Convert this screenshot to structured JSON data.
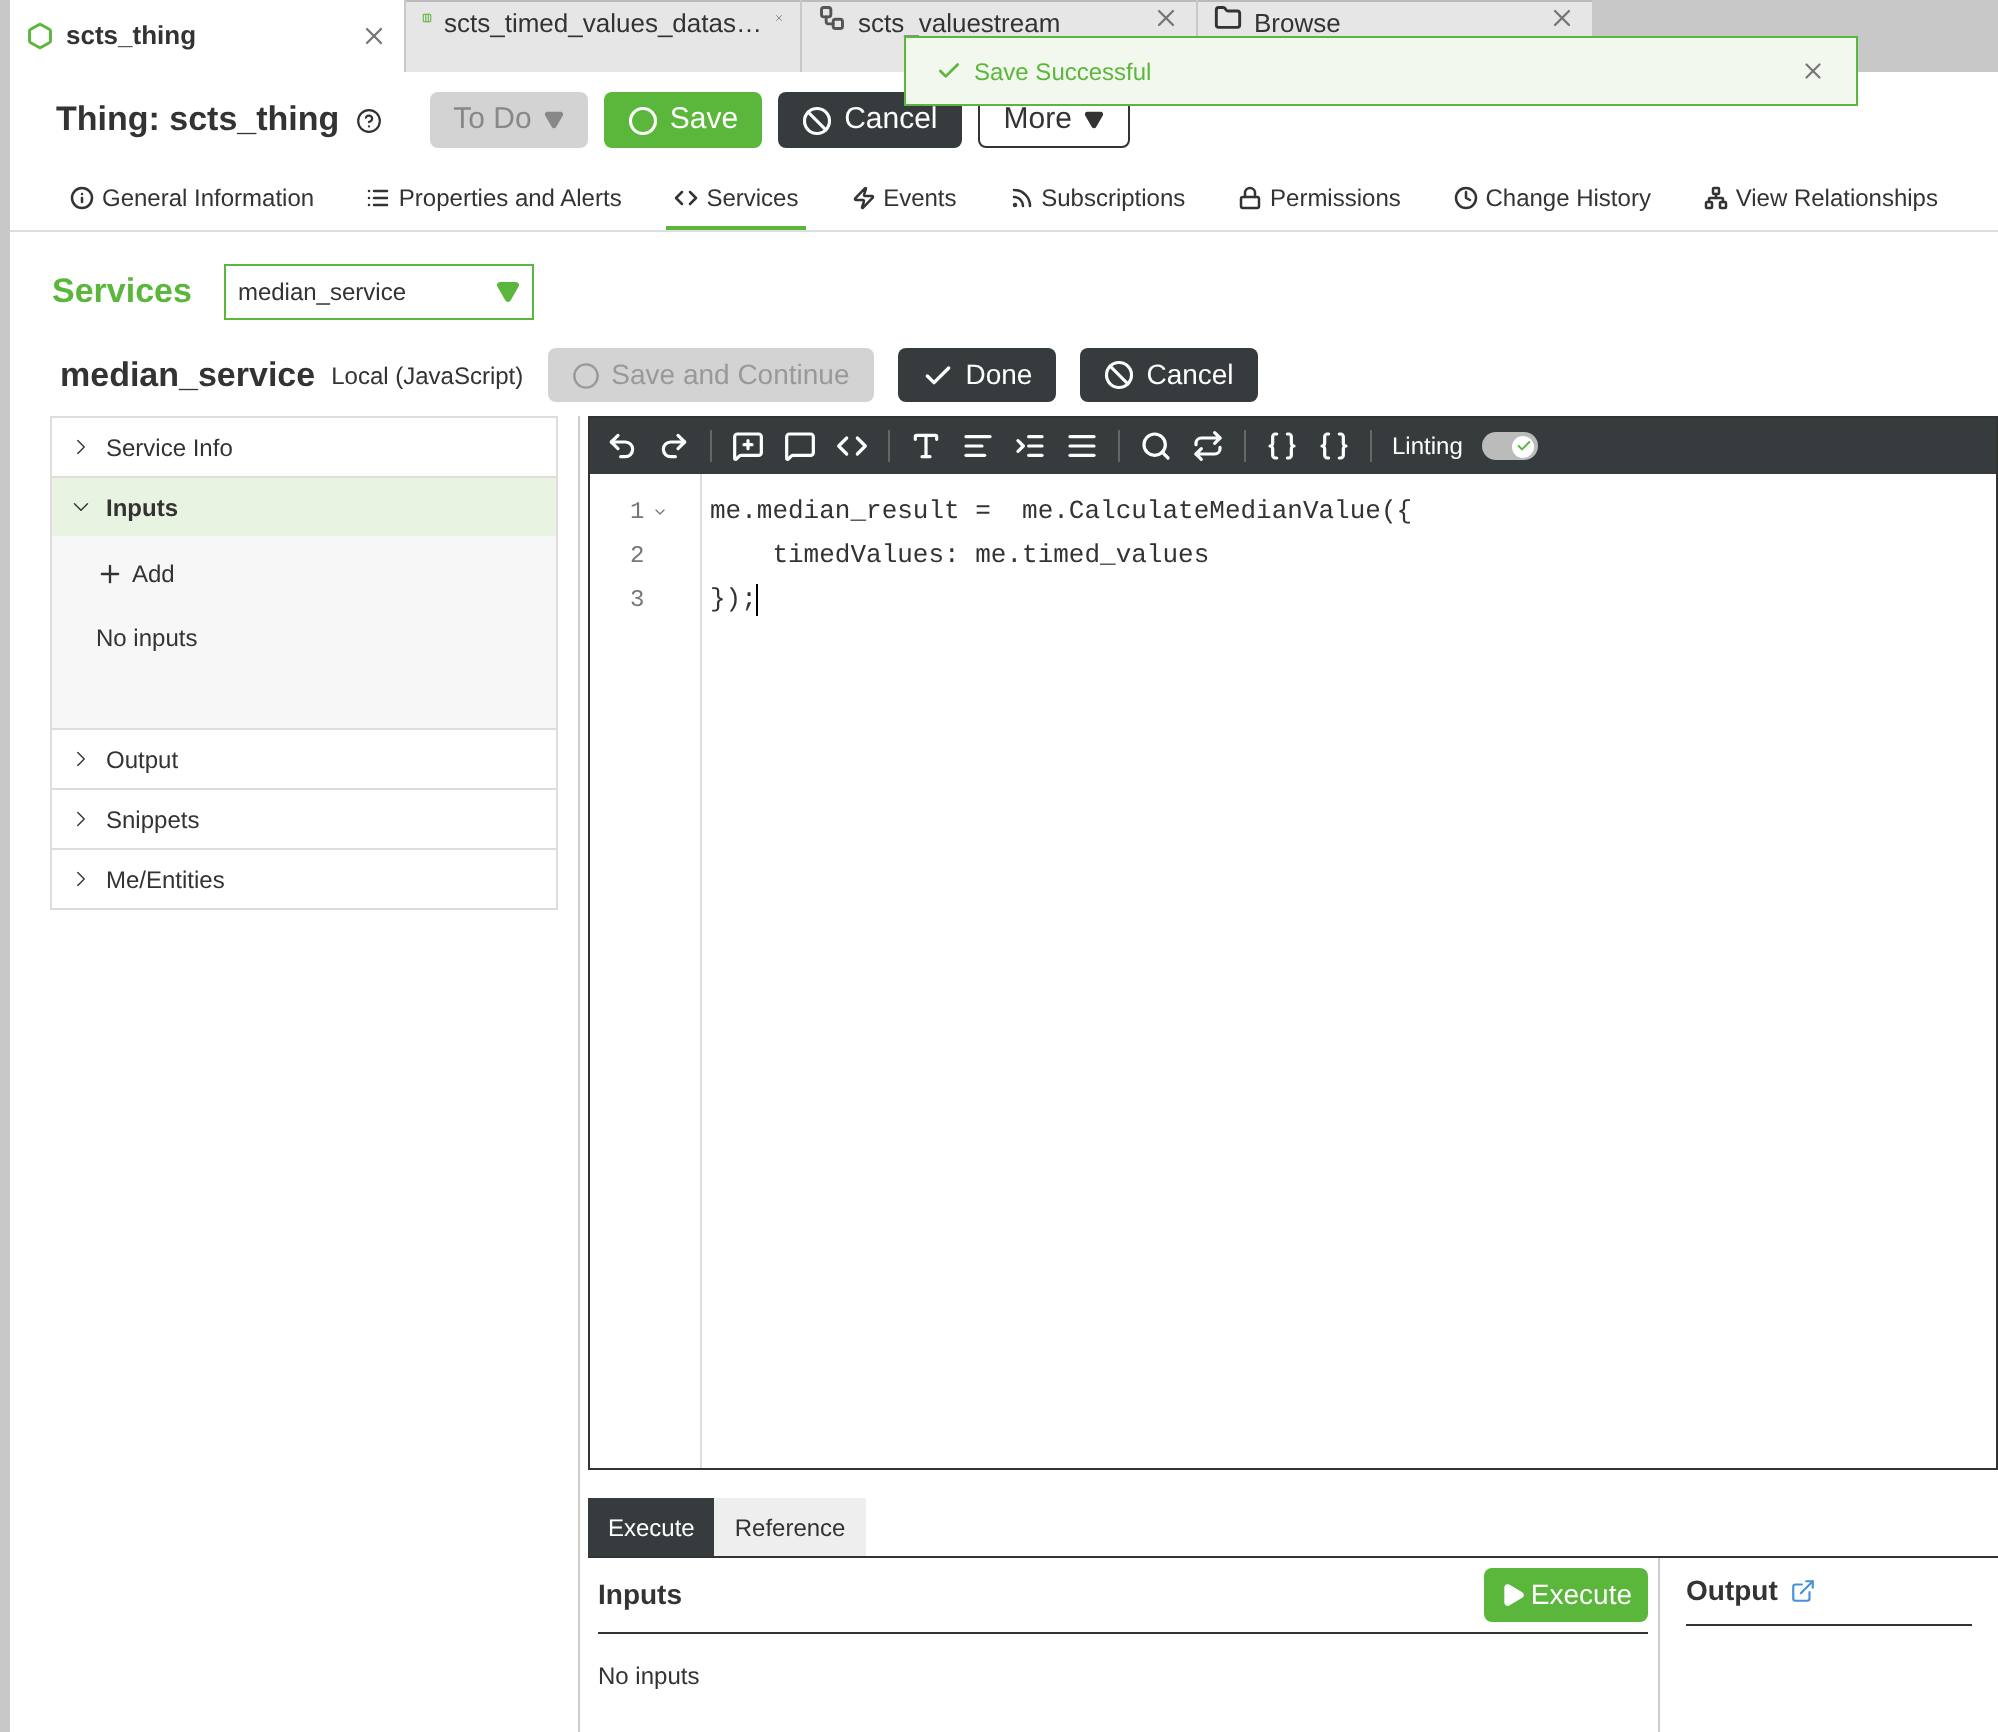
{
  "browser_tabs": [
    {
      "label": "scts_thing",
      "selected": true,
      "kind": "thing"
    },
    {
      "label": "scts_timed_values_datas…",
      "selected": false,
      "kind": "datashape"
    },
    {
      "label": "scts_valuestream",
      "selected": false,
      "kind": "stream"
    },
    {
      "label": "Browse",
      "selected": false,
      "kind": "folder"
    }
  ],
  "toast": {
    "message": "Save Successful"
  },
  "header": {
    "title": "Thing: scts_thing",
    "buttons": [
      {
        "label": "To Do",
        "kind": "disabled-dropdown"
      },
      {
        "label": "Save",
        "kind": "save"
      },
      {
        "label": "Cancel",
        "kind": "cancel"
      },
      {
        "label": "More",
        "kind": "dropdown"
      }
    ]
  },
  "nav_tabs": [
    {
      "label": "General Information",
      "selected": false,
      "kind": "info"
    },
    {
      "label": "Properties and Alerts",
      "selected": false,
      "kind": "list"
    },
    {
      "label": "Services",
      "selected": true,
      "kind": "code"
    },
    {
      "label": "Events",
      "selected": false,
      "kind": "bolt"
    },
    {
      "label": "Subscriptions",
      "selected": false,
      "kind": "rss"
    },
    {
      "label": "Permissions",
      "selected": false,
      "kind": "lock"
    },
    {
      "label": "Change History",
      "selected": false,
      "kind": "clock"
    },
    {
      "label": "View Relationships",
      "selected": false,
      "kind": "tree"
    }
  ],
  "services": {
    "label": "Services",
    "selected_service": "median_service"
  },
  "service_header": {
    "name": "median_service",
    "type": "Local (JavaScript)",
    "buttons": [
      {
        "label": "Save and Continue",
        "kind": "save-continue",
        "disabled": true
      },
      {
        "label": "Done",
        "kind": "done",
        "disabled": false
      },
      {
        "label": "Cancel",
        "kind": "cancel",
        "disabled": false
      }
    ]
  },
  "sections": [
    {
      "label": "Service Info",
      "expanded": false
    },
    {
      "label": "Inputs",
      "expanded": true,
      "add_label": "Add",
      "empty_text": "No inputs"
    },
    {
      "label": "Output",
      "expanded": false
    },
    {
      "label": "Snippets",
      "expanded": false
    },
    {
      "label": "Me/Entities",
      "expanded": false
    }
  ],
  "editor": {
    "linting_label": "Linting",
    "linting_on": true,
    "lines": [
      {
        "number": "1",
        "text": "me.median_result =  me.CalculateMedianValue({",
        "foldable": true
      },
      {
        "number": "2",
        "text": "    timedValues: me.timed_values",
        "foldable": false
      },
      {
        "number": "3",
        "text": "});",
        "foldable": false
      }
    ]
  },
  "bottom_tabs": [
    {
      "label": "Execute",
      "selected": true
    },
    {
      "label": "Reference",
      "selected": false
    }
  ],
  "inputs_panel": {
    "title": "Inputs",
    "execute_label": "Execute",
    "empty_text": "No inputs"
  },
  "output_panel": {
    "title": "Output"
  }
}
